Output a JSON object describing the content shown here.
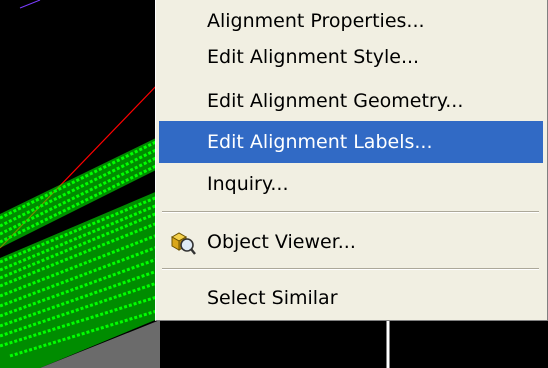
{
  "context_menu": {
    "items": [
      {
        "label": "Alignment Properties..."
      },
      {
        "label": "Edit Alignment Style..."
      },
      {
        "label": "Edit Alignment Geometry..."
      },
      {
        "label": "Edit Alignment Labels...",
        "selected": true
      },
      {
        "label": "Inquiry..."
      },
      {
        "label": "Object Viewer...",
        "icon": "object-viewer-icon"
      },
      {
        "label": "Select Similar"
      }
    ]
  },
  "colors": {
    "menu_background": "#f1efe2",
    "highlight": "#316ac5",
    "highlight_text": "#ffffff",
    "canvas_background": "#000000",
    "point_cloud": "#00ff00",
    "alignment_line": "#ff0000"
  }
}
